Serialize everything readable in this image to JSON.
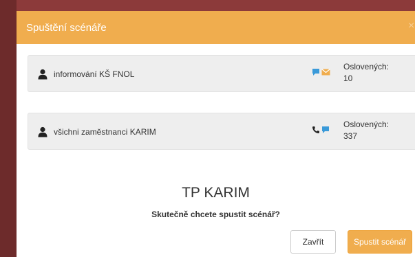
{
  "modal": {
    "title": "Spuštění scénáře",
    "close_glyph": "×"
  },
  "groups": [
    {
      "name": "informování KŠ FNOL",
      "count_label": "Oslovených:",
      "count": "10",
      "channels": [
        "chat-icon",
        "envelope-icon"
      ]
    },
    {
      "name": "všichni zaměstnanci KARIM",
      "count_label": "Oslovených:",
      "count": "337",
      "channels": [
        "phone-icon",
        "chat-icon"
      ]
    }
  ],
  "scenario_name": "TP KARIM",
  "confirm_question": "Skutečně chcete spustit scénář?",
  "buttons": {
    "close_label": "Zavřít",
    "start_label": "Spustit scénář"
  },
  "colors": {
    "accent": "#f0ad4e",
    "icon_blue": "#3a9ad9",
    "icon_yellow": "#f0ad4e"
  }
}
